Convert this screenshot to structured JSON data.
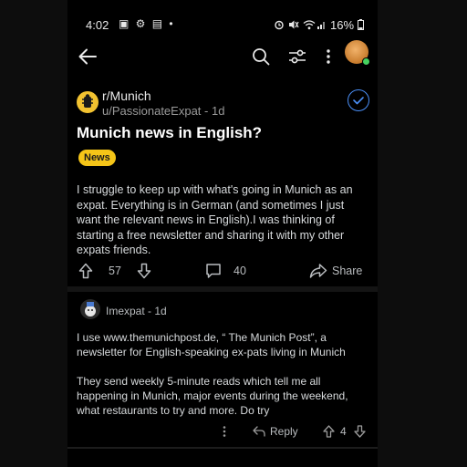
{
  "status_bar": {
    "time": "4:02",
    "battery": "16%"
  },
  "post": {
    "subreddit": "r/Munich",
    "meta": "u/PassionateExpat - 1d",
    "title": "Munich news in English?",
    "flair": "News",
    "body": "I struggle to keep up with what's going in Munich as an expat. Everything is in German (and sometimes I just want the relevant news in English).I was thinking of starting a free newsletter and sharing it with my other expats friends.",
    "votes": "57",
    "comments": "40",
    "share_label": "Share"
  },
  "comment": {
    "meta": "Imexpat - 1d",
    "paragraph1": "I use www.themunichpost.de, “ The Munich Post”,  a newsletter for English-speaking ex-pats living in Munich",
    "paragraph2": "They send weekly 5-minute reads which tell me all happening in Munich, major events during the weekend, what restaurants to try and more. Do try",
    "reply_label": "Reply",
    "votes": "4"
  },
  "colors": {
    "flair_bg": "#f5c518",
    "subreddit_icon": "#f2c230",
    "verified_blue": "#4a8ff7",
    "online_green": "#46d160"
  }
}
